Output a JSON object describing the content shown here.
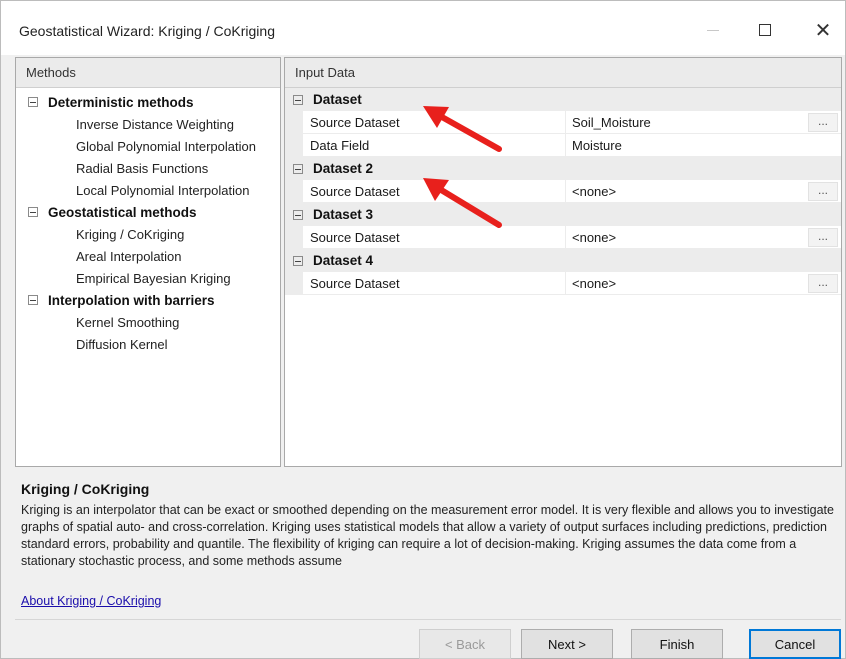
{
  "window": {
    "title": "Geostatistical Wizard: Kriging / CoKriging"
  },
  "methods": {
    "header": "Methods",
    "groups": [
      {
        "label": "Deterministic methods",
        "items": [
          "Inverse Distance Weighting",
          "Global Polynomial Interpolation",
          "Radial Basis Functions",
          "Local Polynomial Interpolation"
        ]
      },
      {
        "label": "Geostatistical methods",
        "items": [
          "Kriging / CoKriging",
          "Areal Interpolation",
          "Empirical Bayesian Kriging"
        ]
      },
      {
        "label": "Interpolation with barriers",
        "items": [
          "Kernel Smoothing",
          "Diffusion Kernel"
        ]
      }
    ]
  },
  "input": {
    "header": "Input Data",
    "datasets": [
      {
        "label": "Dataset",
        "rows": [
          {
            "name": "Source Dataset",
            "value": "Soil_Moisture",
            "ellipsis": "..."
          },
          {
            "name": "Data Field",
            "value": "Moisture"
          }
        ]
      },
      {
        "label": "Dataset 2",
        "rows": [
          {
            "name": "Source Dataset",
            "value": "<none>",
            "ellipsis": "..."
          }
        ]
      },
      {
        "label": "Dataset 3",
        "rows": [
          {
            "name": "Source Dataset",
            "value": "<none>",
            "ellipsis": "..."
          }
        ]
      },
      {
        "label": "Dataset 4",
        "rows": [
          {
            "name": "Source Dataset",
            "value": "<none>",
            "ellipsis": "..."
          }
        ]
      }
    ]
  },
  "description": {
    "title": "Kriging / CoKriging",
    "body": "Kriging is an interpolator that can be exact or smoothed depending on the measurement error model. It is very flexible and allows you to investigate graphs of spatial auto- and cross-correlation. Kriging uses statistical models that allow a variety of output surfaces including predictions, prediction standard errors, probability and quantile. The flexibility of kriging can require a lot of decision-making. Kriging assumes the data come from a stationary stochastic process, and some methods assume",
    "link": "About Kriging / CoKriging"
  },
  "buttons": {
    "back": "< Back",
    "next": "Next >",
    "finish": "Finish",
    "cancel": "Cancel"
  },
  "colors": {
    "annotation_arrow": "#e8201c",
    "link": "#1a0dab",
    "default_button_border": "#0078d7"
  }
}
